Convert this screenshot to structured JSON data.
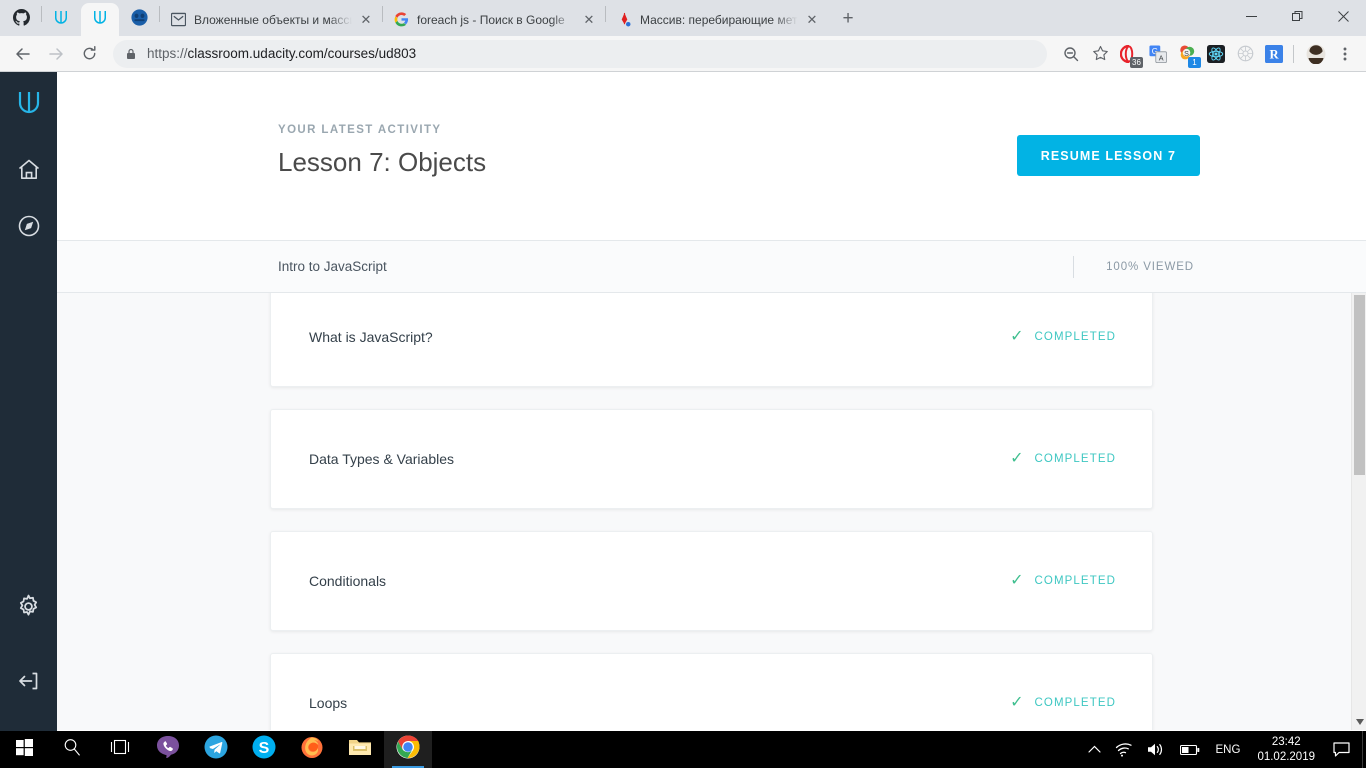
{
  "browser": {
    "pinned_tabs": [
      {
        "name": "github-pinned-tab",
        "icon": "github-icon"
      },
      {
        "name": "udacity-pinned-tab",
        "icon": "udacity-icon"
      },
      {
        "name": "udacity-pinned-tab-active",
        "icon": "udacity-icon"
      },
      {
        "name": "blue-face-pinned-tab",
        "icon": "blue-circle-icon"
      }
    ],
    "tabs": [
      {
        "title": "Вложенные объекты и массивы",
        "favicon": "gmail-m-icon",
        "active": false
      },
      {
        "title": "foreach js - Поиск в Google",
        "favicon": "google-g-icon",
        "active": false
      },
      {
        "title": "Массив: перебирающие методы",
        "favicon": "javascript-ru-icon",
        "active": false
      }
    ],
    "new_tab_label": "+",
    "close_label": "✕",
    "window_controls": {
      "minimize": "—",
      "restore": "❐",
      "close": "✕"
    },
    "nav": {
      "back": "←",
      "forward": "→",
      "reload": "⟳"
    },
    "url_scheme": "https://",
    "url_rest": "classroom.udacity.com/courses/ud803",
    "extensions": [
      {
        "name": "opera-vpn-extension",
        "badge": "36"
      },
      {
        "name": "google-translate-extension",
        "badge": ""
      },
      {
        "name": "skype-extension",
        "badge": "1"
      },
      {
        "name": "react-devtools-extension",
        "badge": ""
      },
      {
        "name": "wheel-extension",
        "badge": ""
      },
      {
        "name": "r-extension",
        "badge": ""
      }
    ],
    "profile_name": "profile-avatar",
    "menu_label": "⋮"
  },
  "sidebar": {
    "logo": "udacity-logo",
    "items": [
      {
        "name": "sidebar-item-home",
        "icon": "home-icon"
      },
      {
        "name": "sidebar-item-explore",
        "icon": "compass-icon"
      }
    ],
    "bottom_items": [
      {
        "name": "sidebar-item-settings",
        "icon": "gear-icon"
      },
      {
        "name": "sidebar-item-logout",
        "icon": "logout-icon"
      }
    ]
  },
  "hero": {
    "kicker": "YOUR LATEST ACTIVITY",
    "title": "Lesson 7: Objects",
    "resume_button": "RESUME LESSON 7"
  },
  "subbar": {
    "course_title": "Intro to JavaScript",
    "progress": "100% VIEWED"
  },
  "lessons": [
    {
      "title": "What is JavaScript?",
      "status": "COMPLETED",
      "check": "✓"
    },
    {
      "title": "Data Types & Variables",
      "status": "COMPLETED",
      "check": "✓"
    },
    {
      "title": "Conditionals",
      "status": "COMPLETED",
      "check": "✓"
    },
    {
      "title": "Loops",
      "status": "COMPLETED",
      "check": "✓"
    }
  ],
  "colors": {
    "accent": "#02b3e4",
    "status": "#3ec7c2",
    "check": "#3fbf8f",
    "sidebar_bg": "#1f2c38"
  },
  "taskbar": {
    "items": [
      {
        "name": "start-button",
        "icon": "windows-icon"
      },
      {
        "name": "search-button",
        "icon": "search-icon"
      },
      {
        "name": "task-view-button",
        "icon": "task-view-icon"
      },
      {
        "name": "viber-taskbar-item",
        "icon": "viber-icon"
      },
      {
        "name": "telegram-taskbar-item",
        "icon": "telegram-icon"
      },
      {
        "name": "skype-taskbar-item",
        "icon": "skype-icon"
      },
      {
        "name": "firefox-taskbar-item",
        "icon": "firefox-icon"
      },
      {
        "name": "file-explorer-taskbar-item",
        "icon": "folder-icon"
      },
      {
        "name": "chrome-taskbar-item",
        "icon": "chrome-icon"
      }
    ],
    "tray": {
      "expand": "∧",
      "language": "ENG",
      "time": "23:42",
      "date": "01.02.2019"
    }
  }
}
